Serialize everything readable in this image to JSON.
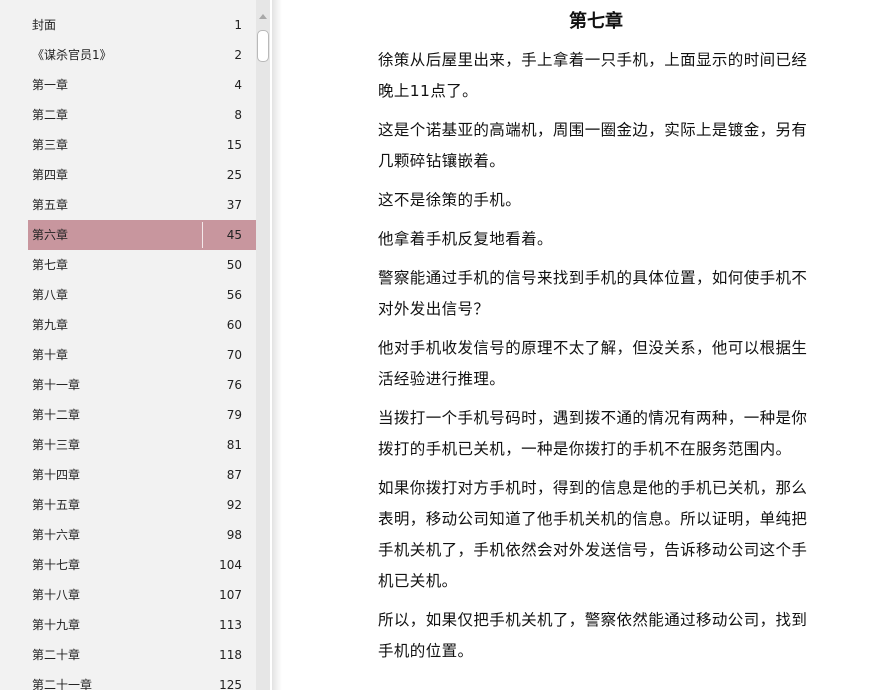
{
  "toc": {
    "selected_index": 7,
    "items": [
      {
        "title": "封面",
        "page": "1"
      },
      {
        "title": "《谋杀官员1》",
        "page": "2"
      },
      {
        "title": "第一章",
        "page": "4"
      },
      {
        "title": "第二章",
        "page": "8"
      },
      {
        "title": "第三章",
        "page": "15"
      },
      {
        "title": "第四章",
        "page": "25"
      },
      {
        "title": "第五章",
        "page": "37"
      },
      {
        "title": "第六章",
        "page": "45"
      },
      {
        "title": "第七章",
        "page": "50"
      },
      {
        "title": "第八章",
        "page": "56"
      },
      {
        "title": "第九章",
        "page": "60"
      },
      {
        "title": "第十章",
        "page": "70"
      },
      {
        "title": "第十一章",
        "page": "76"
      },
      {
        "title": "第十二章",
        "page": "79"
      },
      {
        "title": "第十三章",
        "page": "81"
      },
      {
        "title": "第十四章",
        "page": "87"
      },
      {
        "title": "第十五章",
        "page": "92"
      },
      {
        "title": "第十六章",
        "page": "98"
      },
      {
        "title": "第十七章",
        "page": "104"
      },
      {
        "title": "第十八章",
        "page": "107"
      },
      {
        "title": "第十九章",
        "page": "113"
      },
      {
        "title": "第二十章",
        "page": "118"
      },
      {
        "title": "第二十一章",
        "page": "125"
      }
    ]
  },
  "reader": {
    "chapter_title": "第七章",
    "paragraphs": [
      "徐策从后屋里出来，手上拿着一只手机，上面显示的时间已经晚上11点了。",
      "这是个诺基亚的高端机，周围一圈金边，实际上是镀金，另有几颗碎钻镶嵌着。",
      "这不是徐策的手机。",
      "他拿着手机反复地看着。",
      "警察能通过手机的信号来找到手机的具体位置，如何使手机不对外发出信号？",
      "他对手机收发信号的原理不太了解，但没关系，他可以根据生活经验进行推理。",
      "当拨打一个手机号码时，遇到拨不通的情况有两种，一种是你拨打的手机已关机，一种是你拨打的手机不在服务范围内。",
      "如果你拨打对方手机时，得到的信息是他的手机已关机，那么表明，移动公司知道了他手机关机的信息。所以证明，单纯把手机关机了，手机依然会对外发送信号，告诉移动公司这个手机已关机。",
      "所以，如果仅把手机关机了，警察依然能通过移动公司，找到手机的位置。"
    ]
  },
  "colors": {
    "sidebar_bg": "#f2f2f2",
    "selected_row": "#c8969e",
    "text": "#111111"
  }
}
